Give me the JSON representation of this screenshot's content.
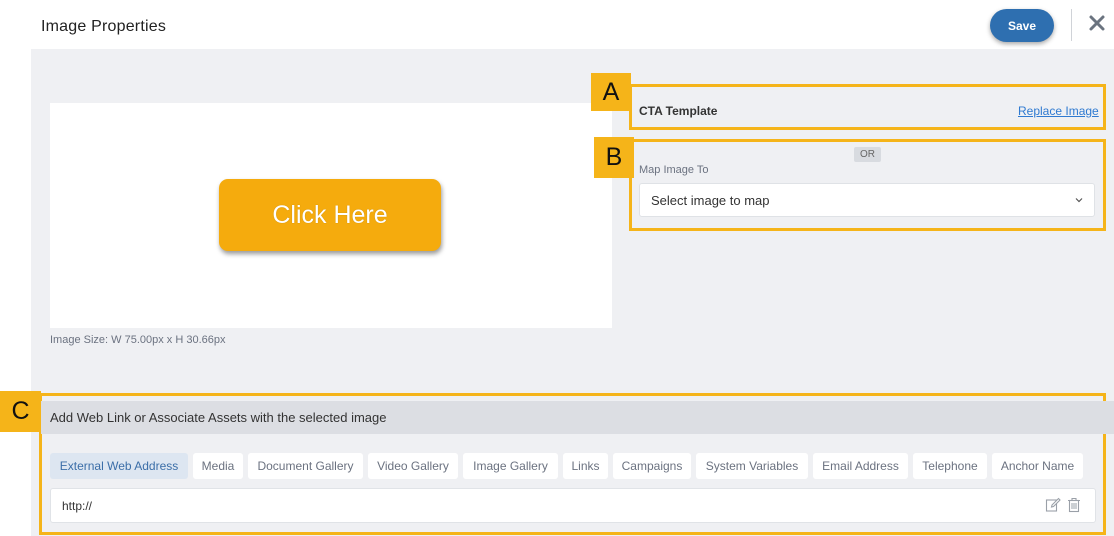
{
  "header": {
    "title": "Image Properties",
    "save_label": "Save",
    "close_icon": "close-icon"
  },
  "preview": {
    "button_text": "Click Here",
    "image_size": "Image Size: W 75.00px x H 30.66px"
  },
  "markers": {
    "a": "A",
    "b": "B",
    "c": "C"
  },
  "template": {
    "label": "CTA Template",
    "replace_link": "Replace Image"
  },
  "mapping": {
    "or_label": "OR",
    "label": "Map Image To",
    "select_value": "Select image to map"
  },
  "assets": {
    "title": "Add Web Link or Associate Assets with the selected image",
    "tabs": [
      {
        "label": "External Web Address",
        "active": true
      },
      {
        "label": "Media",
        "active": false
      },
      {
        "label": "Document Gallery",
        "active": false
      },
      {
        "label": "Video Gallery",
        "active": false
      },
      {
        "label": "Image Gallery",
        "active": false
      },
      {
        "label": "Links",
        "active": false
      },
      {
        "label": "Campaigns",
        "active": false
      },
      {
        "label": "System Variables",
        "active": false
      },
      {
        "label": "Email Address",
        "active": false
      },
      {
        "label": "Telephone",
        "active": false
      },
      {
        "label": "Anchor Name",
        "active": false
      }
    ],
    "url_value": "http://"
  },
  "colors": {
    "accent": "#2e6fb0",
    "annotation": "#f5b419",
    "cta_button": "#f5ab0d",
    "link": "#2f7ad1"
  }
}
